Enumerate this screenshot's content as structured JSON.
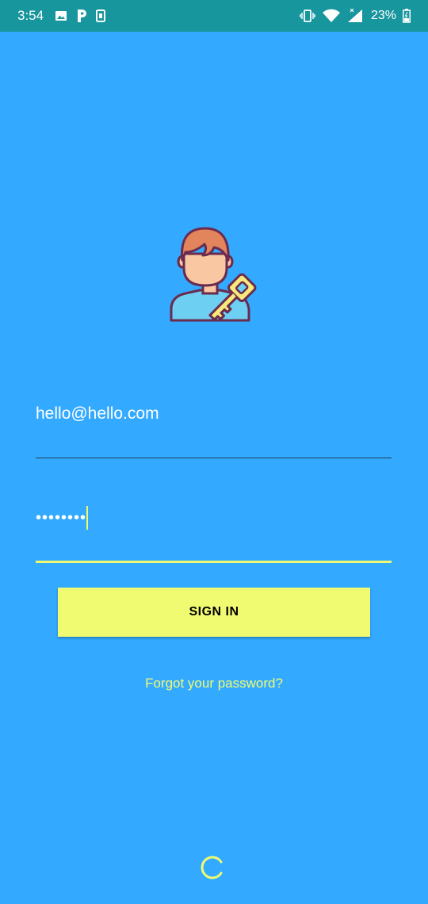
{
  "status_bar": {
    "time": "3:54",
    "left_icons": [
      "image-icon",
      "parking-icon",
      "sd-card-icon"
    ],
    "right_icons": [
      "vibrate-icon",
      "wifi-icon",
      "cell-signal-icon",
      "battery-icon"
    ],
    "battery": "23%"
  },
  "login": {
    "avatar": "user-key-avatar-icon",
    "email_value": "hello@hello.com",
    "password_value": "••••••••",
    "signin_label": "SIGN IN",
    "forgot_label": "Forgot your password?"
  },
  "colors": {
    "background": "#33aaff",
    "status_bar": "#17969e",
    "accent": "#f0fb72"
  }
}
